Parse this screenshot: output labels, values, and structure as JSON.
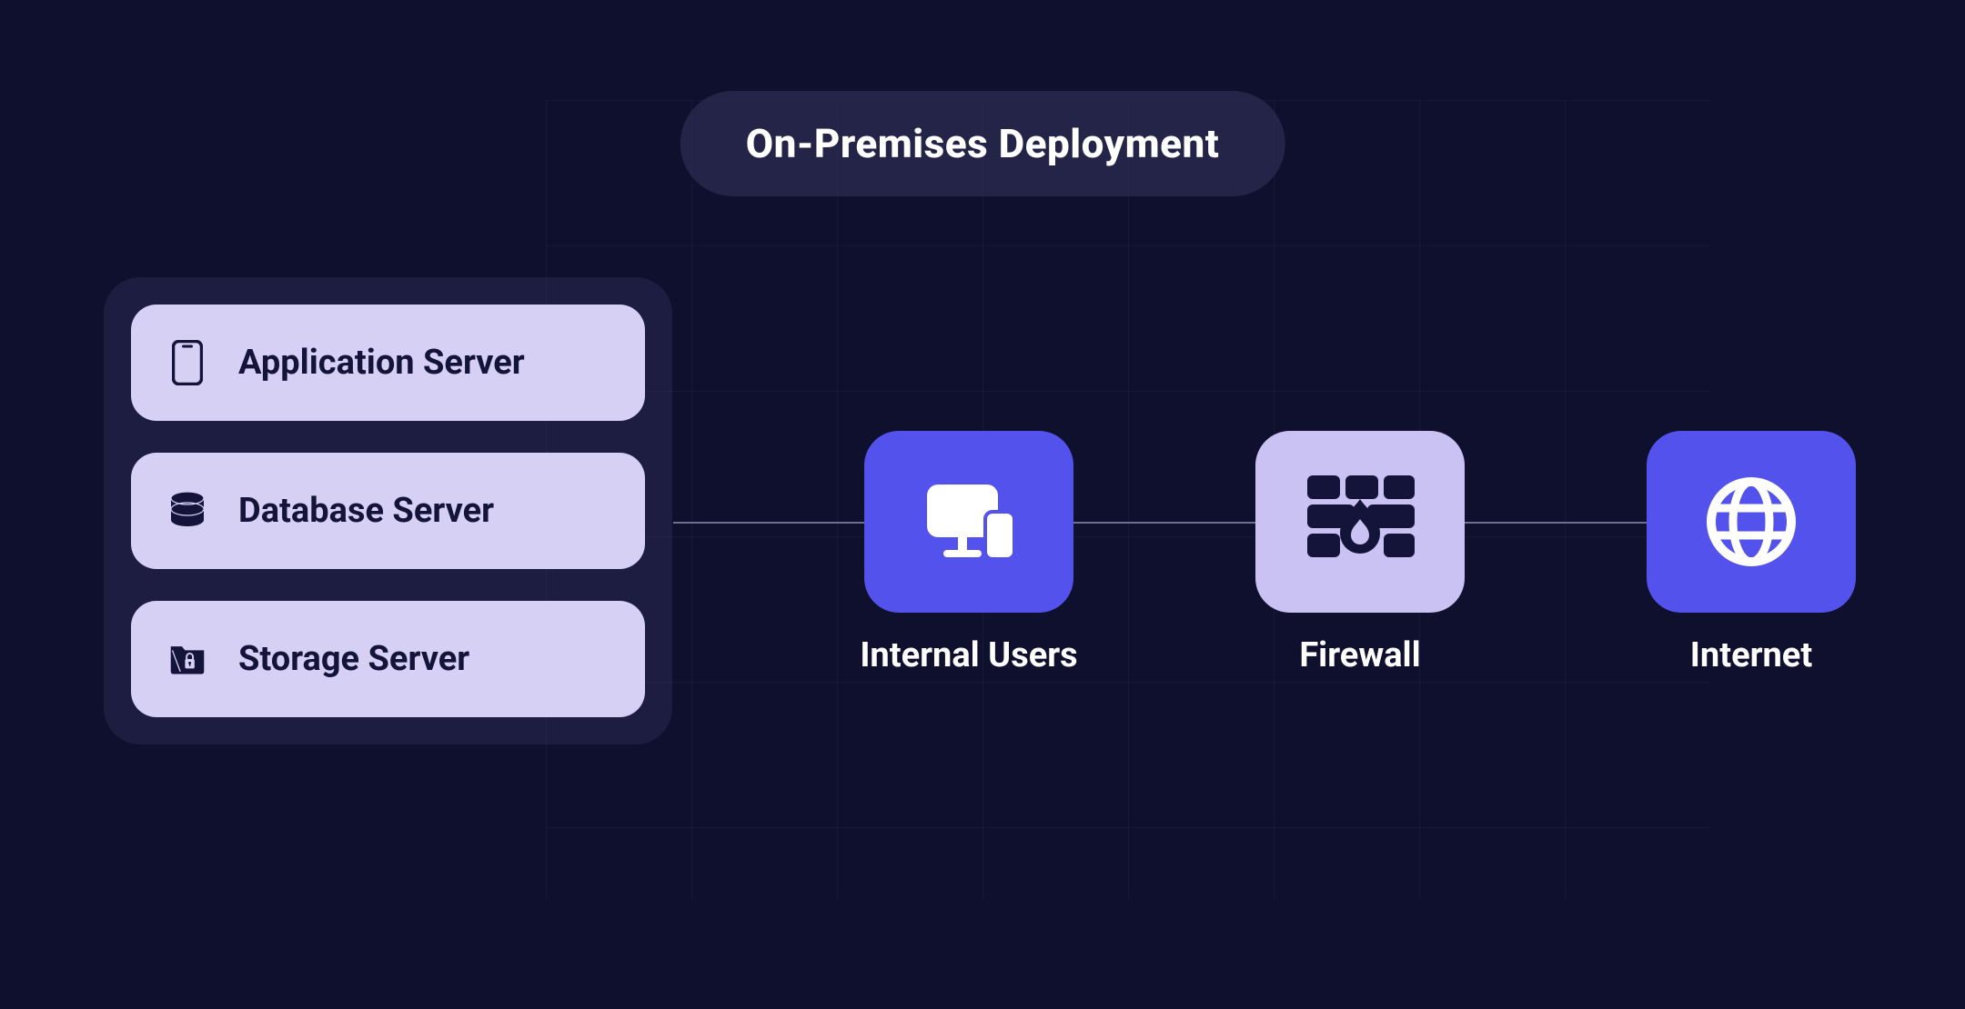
{
  "title": "On-Premises Deployment",
  "servers": {
    "application": {
      "label": "Application Server",
      "icon": "phone-icon"
    },
    "database": {
      "label": "Database Server",
      "icon": "database-icon"
    },
    "storage": {
      "label": "Storage Server",
      "icon": "folder-lock-icon"
    }
  },
  "nodes": {
    "internal_users": {
      "label": "Internal Users",
      "icon": "devices-icon",
      "color": "blue"
    },
    "firewall": {
      "label": "Firewall",
      "icon": "firewall-icon",
      "color": "lavender"
    },
    "internet": {
      "label": "Internet",
      "icon": "globe-icon",
      "color": "blue"
    }
  },
  "colors": {
    "background": "#0f0f2e",
    "accent_blue": "#5352ed",
    "lavender": "#c9c2f2",
    "card": "#d6d0f5",
    "text_dark": "#14143a",
    "text_light": "#ffffff"
  }
}
